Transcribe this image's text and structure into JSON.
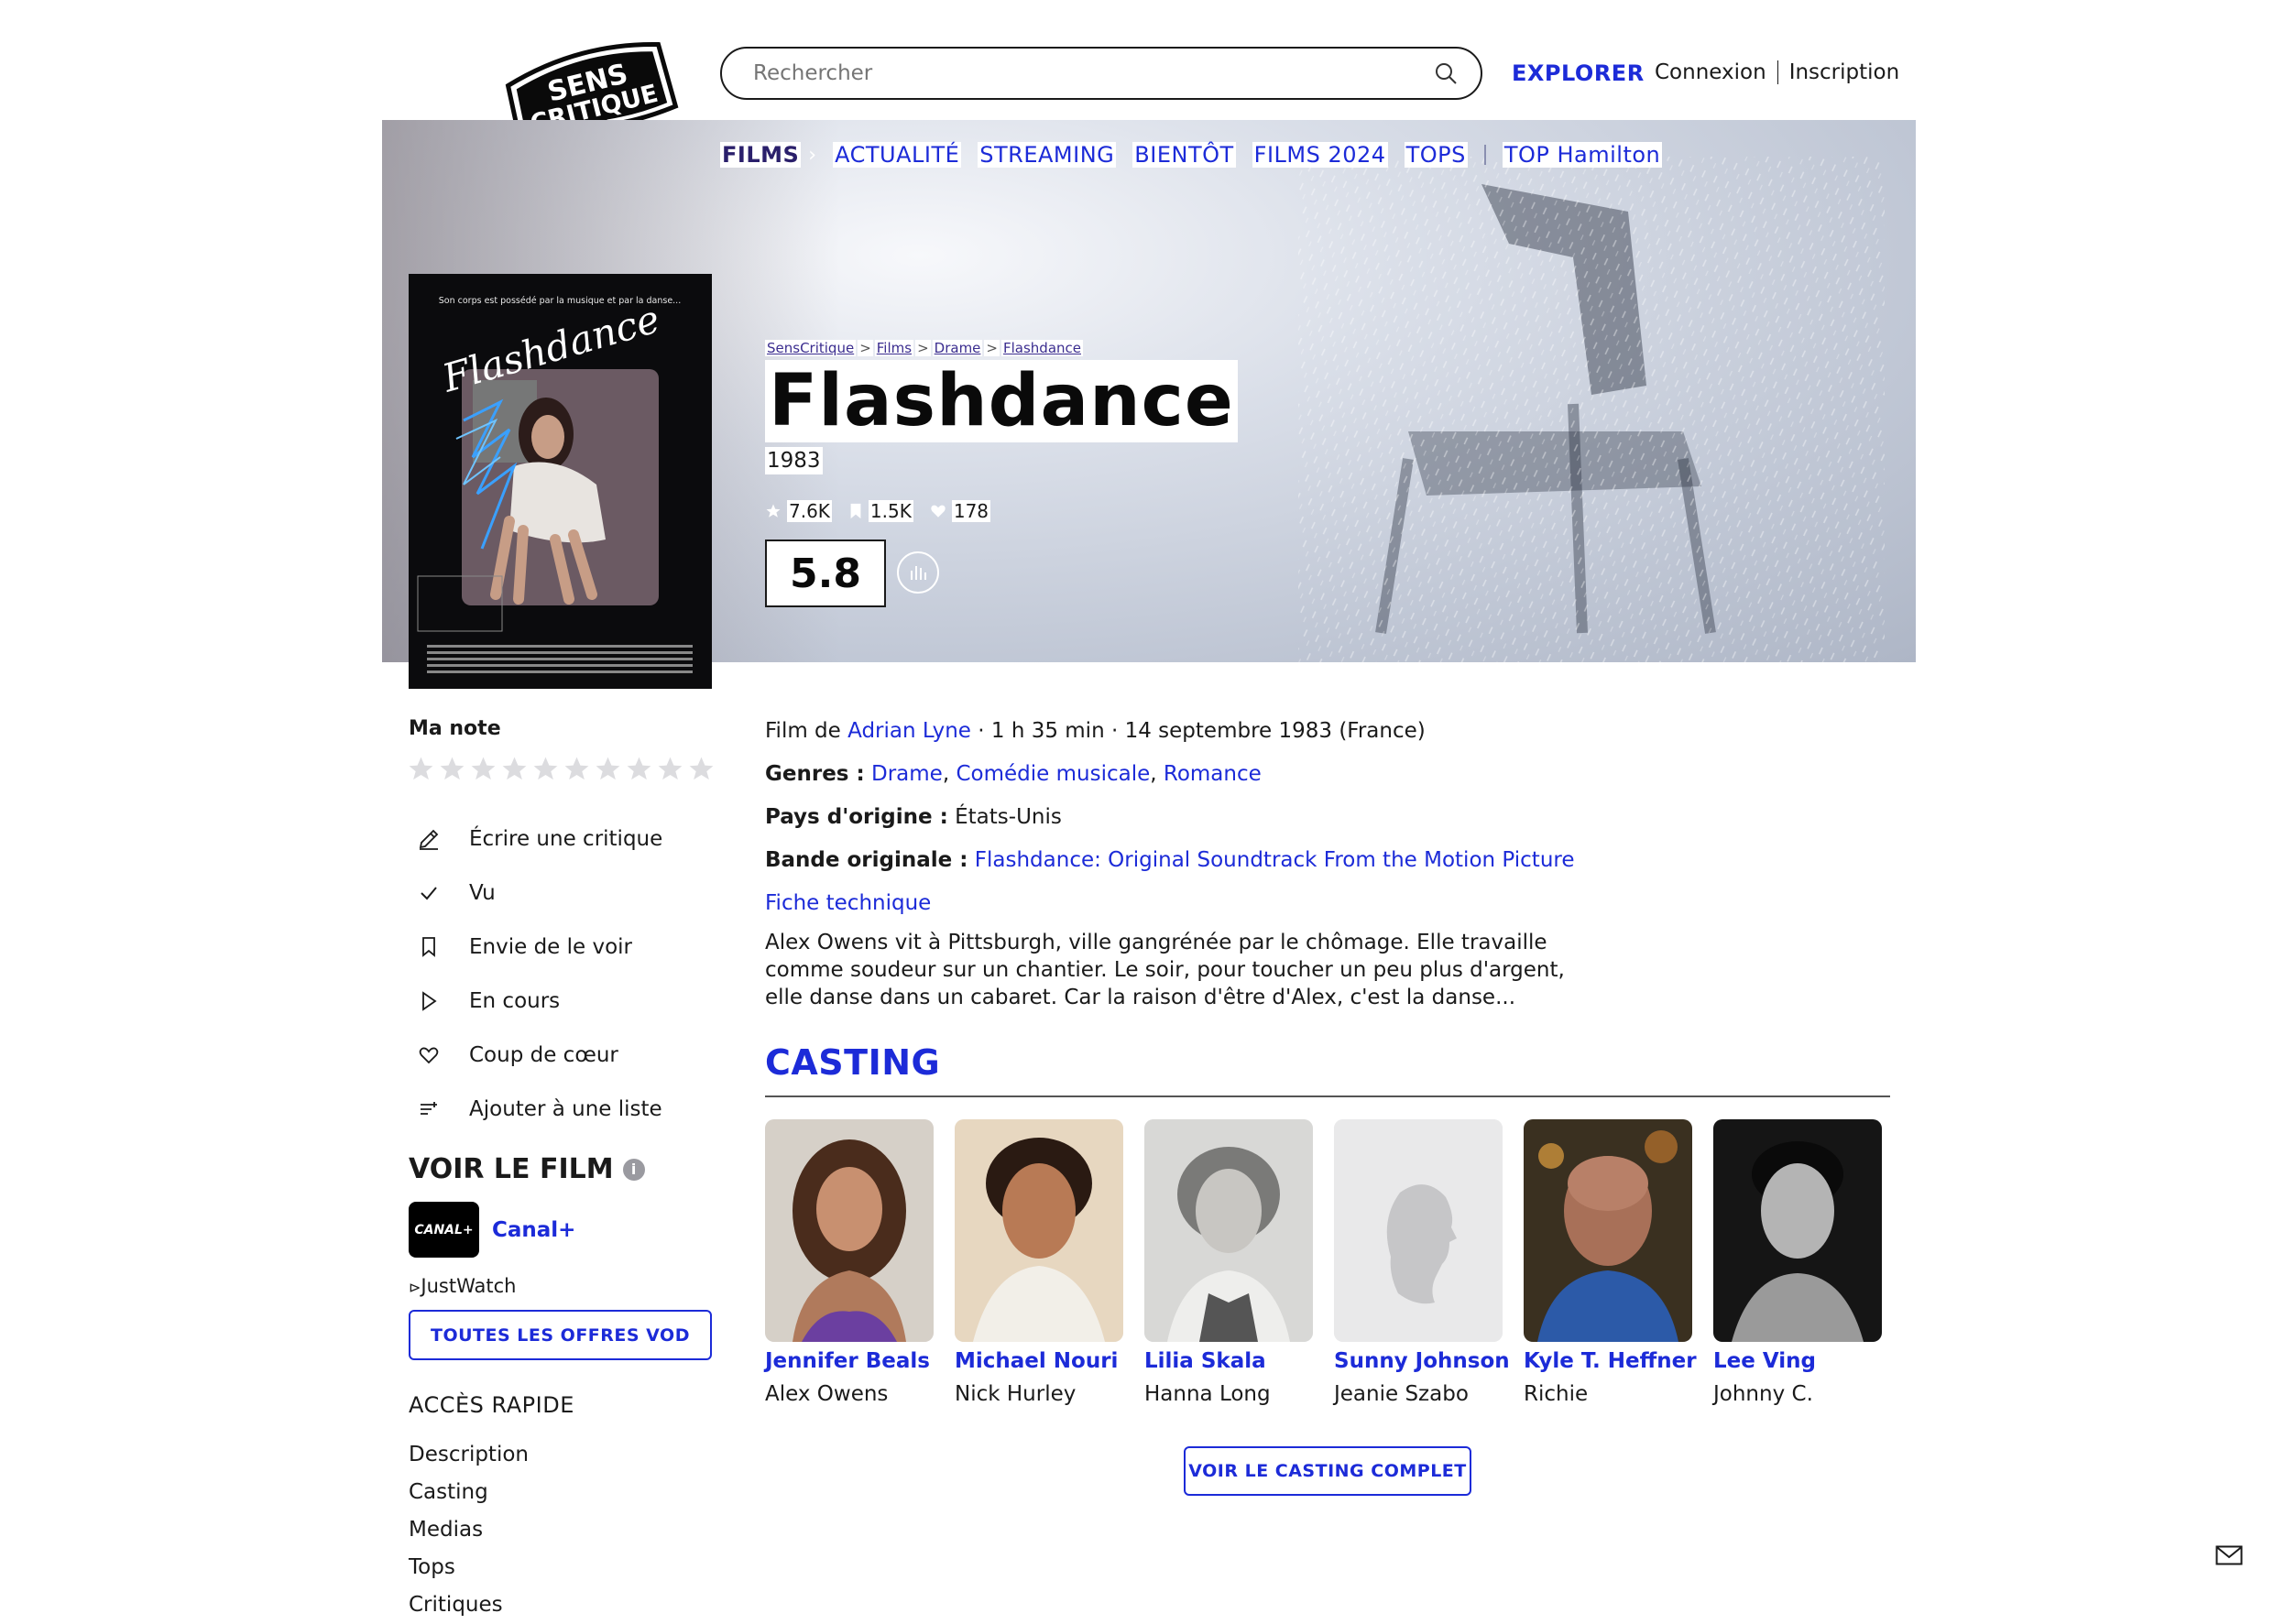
{
  "header": {
    "logo_text_line1": "SENS",
    "logo_text_line2": "CRITIQUE",
    "search_placeholder": "Rechercher",
    "explorer_label": "EXPLORER",
    "login_label": "Connexion",
    "signup_label": "Inscription"
  },
  "nav": {
    "items": [
      "FILMS",
      "ACTUALITÉ",
      "STREAMING",
      "BIENTÔT",
      "FILMS 2024",
      "TOPS",
      "TOP Hamilton"
    ]
  },
  "breadcrumb": [
    "SensCritique",
    "Films",
    "Drame",
    "Flashdance"
  ],
  "breadcrumb_separator": ">",
  "movie": {
    "title": "Flashdance",
    "year": "1983",
    "ratings_count": "7.6K",
    "wishlist_count": "1.5K",
    "favorites_count": "178",
    "score": "5.8",
    "poster_tagline": "Son corps est possédé par la musique et par la danse...",
    "poster_title": "Flashdance"
  },
  "details": {
    "film_de_label": "Film de",
    "director": "Adrian Lyne",
    "runtime_release": " · 1 h 35 min · 14 septembre 1983 (France)",
    "genres_label": "Genres :",
    "genres": [
      "Drame",
      "Comédie musicale",
      "Romance"
    ],
    "pays_label": "Pays d'origine :",
    "pays": "États-Unis",
    "bo_label": "Bande originale :",
    "bo": "Flashdance: Original Soundtrack From the Motion Picture",
    "fiche_label": "Fiche technique",
    "synopsis": "Alex Owens vit à Pittsburgh, ville gangrénée par le chômage. Elle travaille comme soudeur sur un chantier. Le soir, pour toucher un peu plus d'argent, elle danse dans un cabaret. Car la raison d'être d'Alex, c'est la danse..."
  },
  "sidebar": {
    "ma_note_label": "Ma note",
    "stars_count": 10,
    "actions": [
      {
        "icon": "pencil-icon",
        "label": "Écrire une critique"
      },
      {
        "icon": "check-icon",
        "label": "Vu"
      },
      {
        "icon": "bookmark-icon",
        "label": "Envie de le voir"
      },
      {
        "icon": "play-icon",
        "label": "En cours"
      },
      {
        "icon": "heart-icon",
        "label": "Coup de cœur"
      },
      {
        "icon": "list-add-icon",
        "label": "Ajouter à une liste"
      }
    ],
    "voir_le_film_label": "VOIR LE FILM",
    "provider_logo_text": "CANAL+",
    "provider_name": "Canal+",
    "justwatch_label": "JustWatch",
    "vod_button_label": "TOUTES LES OFFRES VOD",
    "acces_rapide_label": "ACCÈS RAPIDE",
    "quick_links": [
      "Description",
      "Casting",
      "Medias",
      "Tops",
      "Critiques"
    ]
  },
  "casting": {
    "title": "CASTING",
    "actors": [
      {
        "name": "Jennifer Beals",
        "role": "Alex Owens"
      },
      {
        "name": "Michael Nouri",
        "role": "Nick Hurley"
      },
      {
        "name": "Lilia Skala",
        "role": "Hanna Long"
      },
      {
        "name": "Sunny Johnson",
        "role": "Jeanie Szabo"
      },
      {
        "name": "Kyle T. Heffner",
        "role": "Richie"
      },
      {
        "name": "Lee Ving",
        "role": "Johnny C."
      }
    ],
    "full_cast_button": "VOIR LE CASTING COMPLET"
  },
  "colors": {
    "accent": "#1c2bd8",
    "nav_active": "#2a1f6b",
    "text": "#1a1a1a"
  }
}
